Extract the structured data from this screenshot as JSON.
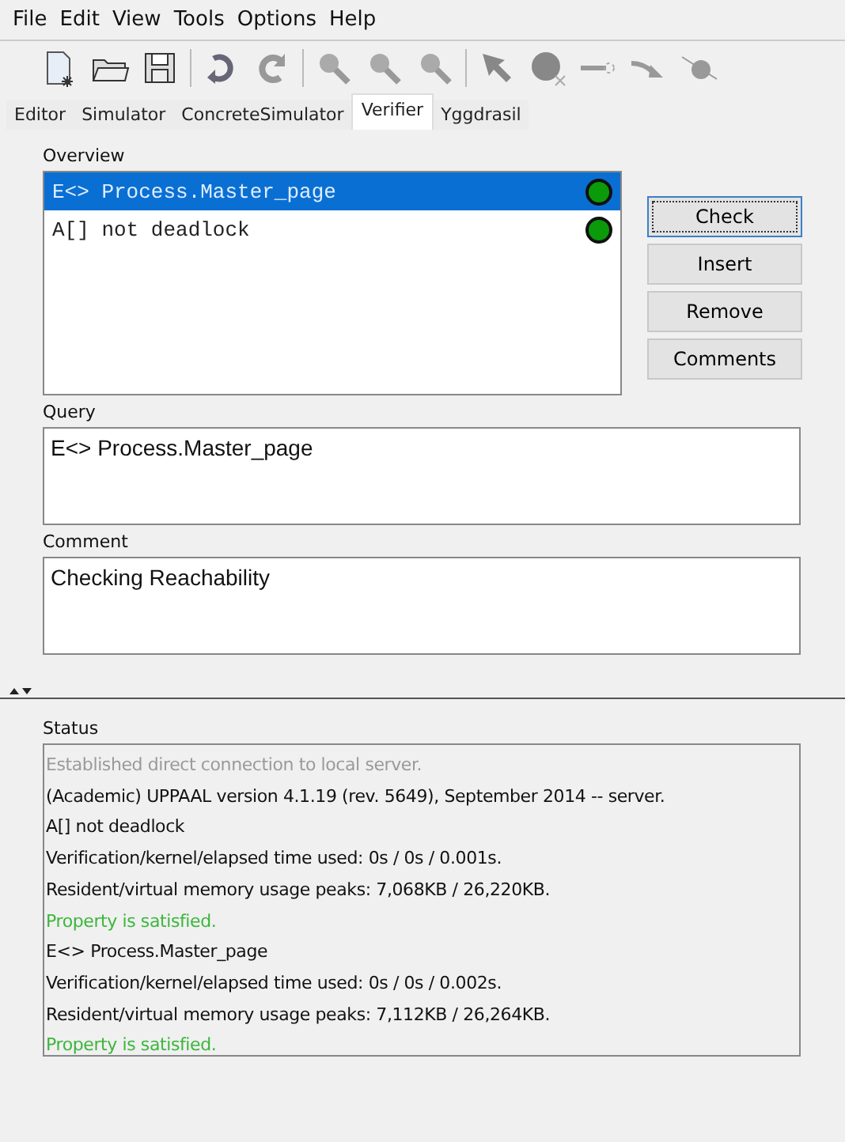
{
  "menu": [
    "File",
    "Edit",
    "View",
    "Tools",
    "Options",
    "Help"
  ],
  "tabs": [
    {
      "label": "Editor",
      "selected": false
    },
    {
      "label": "Simulator",
      "selected": false
    },
    {
      "label": "ConcreteSimulator",
      "selected": false
    },
    {
      "label": "Verifier",
      "selected": true
    },
    {
      "label": "Yggdrasil",
      "selected": false
    }
  ],
  "overview": {
    "title": "Overview",
    "queries": [
      {
        "text": "E<> Process.Master_page",
        "selected": true,
        "color": "#0a9a0a"
      },
      {
        "text": "A[] not deadlock",
        "selected": false,
        "color": "#0a9a0a"
      }
    ]
  },
  "buttons": [
    {
      "label": "Check",
      "focused": true
    },
    {
      "label": "Insert",
      "focused": false
    },
    {
      "label": "Remove",
      "focused": false
    },
    {
      "label": "Comments",
      "focused": false
    }
  ],
  "query": {
    "title": "Query",
    "value": "E<> Process.Master_page"
  },
  "comment": {
    "title": "Comment",
    "value": "Checking Reachability"
  },
  "status": {
    "title": "Status",
    "lines": [
      {
        "text": "Established direct connection to local server.",
        "kind": "info"
      },
      {
        "text": "(Academic) UPPAAL version 4.1.19 (rev. 5649), September 2014 -- server.",
        "kind": "normal"
      },
      {
        "text": "A[] not deadlock",
        "kind": "normal"
      },
      {
        "text": "Verification/kernel/elapsed time used: 0s / 0s / 0.001s.",
        "kind": "normal"
      },
      {
        "text": "Resident/virtual memory usage peaks: 7,068KB / 26,220KB.",
        "kind": "normal"
      },
      {
        "text": "Property is satisfied.",
        "kind": "success"
      },
      {
        "text": "E<> Process.Master_page",
        "kind": "normal"
      },
      {
        "text": "Verification/kernel/elapsed time used: 0s / 0s / 0.002s.",
        "kind": "normal"
      },
      {
        "text": "Resident/virtual memory usage peaks: 7,112KB / 26,264KB.",
        "kind": "normal"
      },
      {
        "text": "Property is satisfied.",
        "kind": "success"
      }
    ]
  }
}
